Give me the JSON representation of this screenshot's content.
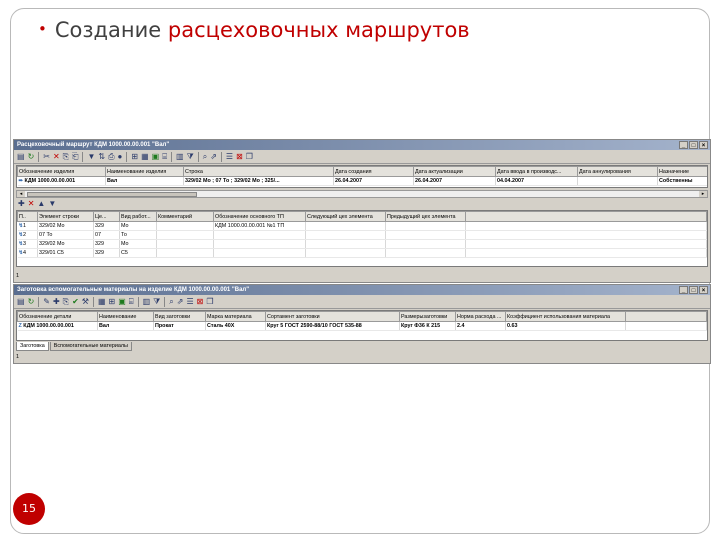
{
  "slide": {
    "bullet": "•",
    "title_plain": "Создание",
    "title_accent": "расцеховочных маршрутов",
    "page_number": "15",
    "accent_color": "#c00000"
  },
  "window1": {
    "title": "Расцеховочный маршрут КДМ 1000.00.00.001 \"Вал\"",
    "top_grid": {
      "headers": [
        "Обозначение изделия",
        "Наименование изделия",
        "Строка",
        "Дата создания",
        "Дата актуализации",
        "Дата ввода в производс...",
        "Дата аннулирования",
        "Назначение"
      ],
      "rows": [
        [
          "КДМ 1000.00.00.001",
          "Вал",
          "329/02 Мо  ;  07 То  ;  329/02 Мо  ;  325/...",
          "26.04.2007",
          "26.04.2007",
          "04.04.2007",
          "",
          "Собственны"
        ]
      ]
    },
    "bottom_grid": {
      "headers": [
        "П..",
        "Элемент строки",
        "Це...",
        "Вид работ...",
        "Комментарий",
        "Обозначение основного ТП",
        "Следующий цех элемента",
        "Предыдущий цех элемента"
      ],
      "rows": [
        [
          "1",
          "329/02 Мо",
          "329",
          "Мо",
          "",
          "КДМ 1000.00.00.001 №1 ТП",
          "",
          ""
        ],
        [
          "2",
          "07 То",
          "07",
          "То",
          "",
          "",
          "",
          ""
        ],
        [
          "3",
          "329/02 Мо",
          "329",
          "Мо",
          "",
          "",
          "",
          ""
        ],
        [
          "4",
          "329/01 С5",
          "329",
          "С5",
          "",
          "",
          "",
          ""
        ]
      ]
    },
    "status": "1"
  },
  "window2": {
    "title": "Заготовка вспомогательные материалы на изделие КДМ 1000.00.00.001 \"Вал\"",
    "grid": {
      "headers": [
        "Обозначение детали",
        "Наименование",
        "Вид заготовки",
        "Марка материала",
        "Сортамент заготовки",
        "Размерызаготовки",
        "Норма расхода ...",
        "Коэффициент использования материала"
      ],
      "rows": [
        [
          "КДМ 1000.00.00.001",
          "Вал",
          "Прокат",
          "Сталь 40Х",
          "Круг  5 ГОСТ 2590-88/10 ГОСТ 535-88",
          "Круг Ф36 К 215",
          "2.4",
          "0.63"
        ]
      ]
    },
    "tabs": [
      "Заготовка",
      "Вспомогательные материалы"
    ],
    "status": "1"
  }
}
